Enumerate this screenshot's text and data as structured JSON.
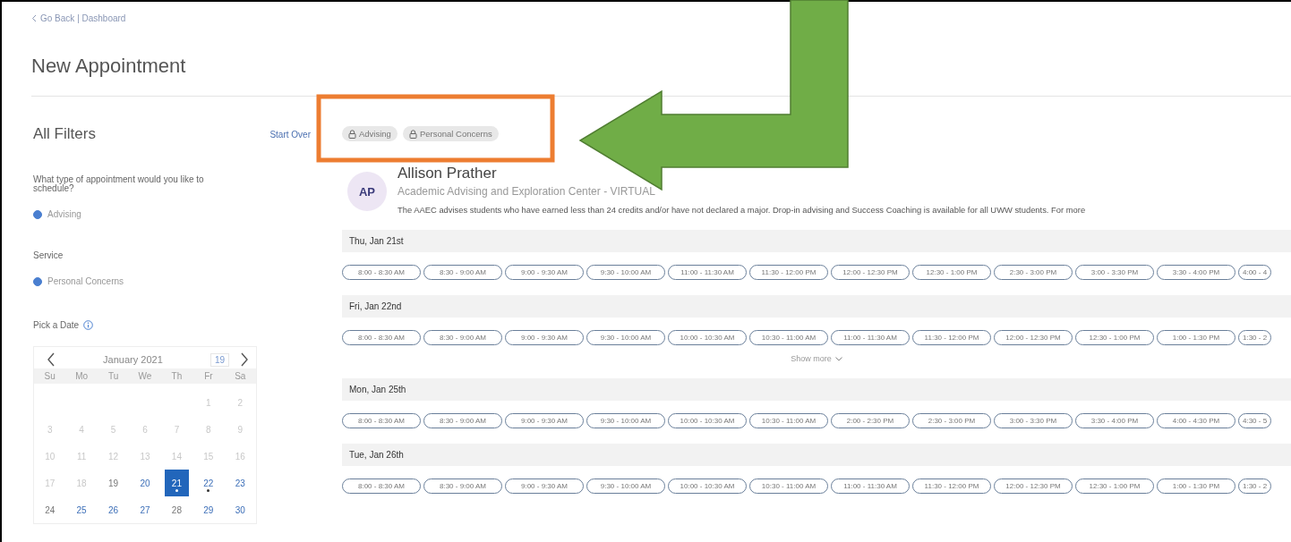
{
  "back_link": "Go Back | Dashboard",
  "page_title": "New Appointment",
  "filters": {
    "title": "All Filters",
    "reset": "Start Over",
    "groups": [
      {
        "label": "What type of appointment would you like to schedule?",
        "options": [
          {
            "label": "Advising",
            "selected": true
          }
        ]
      },
      {
        "label": "Service",
        "options": [
          {
            "label": "Personal Concerns",
            "selected": true
          }
        ]
      }
    ],
    "date_picker": {
      "label": "Pick a Date",
      "month": "January 2021",
      "today": "19",
      "weekdays": [
        "Su",
        "Mo",
        "Tu",
        "We",
        "Th",
        "Fr",
        "Sa"
      ],
      "weeks": [
        [
          {
            "label": "1",
            "disabled": true,
            "selected": false,
            "dot": false
          },
          {
            "label": "2",
            "disabled": true,
            "selected": false,
            "dot": false
          }
        ],
        [
          {
            "label": "3",
            "disabled": true,
            "selected": false,
            "dot": false
          },
          {
            "label": "4",
            "disabled": true,
            "selected": false,
            "dot": false
          },
          {
            "label": "5",
            "disabled": true,
            "selected": false,
            "dot": false
          },
          {
            "label": "6",
            "disabled": true,
            "selected": false,
            "dot": false
          },
          {
            "label": "7",
            "disabled": true,
            "selected": false,
            "dot": false
          },
          {
            "label": "8",
            "disabled": true,
            "selected": false,
            "dot": false
          },
          {
            "label": "9",
            "disabled": true,
            "selected": false,
            "dot": false
          }
        ],
        [
          {
            "label": "10",
            "disabled": true,
            "selected": false,
            "dot": false
          },
          {
            "label": "11",
            "disabled": true,
            "selected": false,
            "dot": false
          },
          {
            "label": "12",
            "disabled": true,
            "selected": false,
            "dot": false
          },
          {
            "label": "13",
            "disabled": true,
            "selected": false,
            "dot": false
          },
          {
            "label": "14",
            "disabled": true,
            "selected": false,
            "dot": false
          },
          {
            "label": "15",
            "disabled": true,
            "selected": false,
            "dot": false
          },
          {
            "label": "16",
            "disabled": true,
            "selected": false,
            "dot": false
          }
        ],
        [
          {
            "label": "17",
            "disabled": true,
            "selected": false,
            "dot": false
          },
          {
            "label": "18",
            "disabled": true,
            "selected": false,
            "dot": false
          },
          {
            "label": "19",
            "disabled": false,
            "available": false,
            "selected": false,
            "dot": false
          },
          {
            "label": "20",
            "disabled": false,
            "available": true,
            "selected": false,
            "dot": false
          },
          {
            "label": "21",
            "disabled": false,
            "available": true,
            "selected": true,
            "dot": true
          },
          {
            "label": "22",
            "disabled": false,
            "available": true,
            "selected": false,
            "dot": true
          },
          {
            "label": "23",
            "disabled": false,
            "available": true,
            "selected": false,
            "dot": false
          }
        ],
        [
          {
            "label": "24",
            "disabled": false,
            "available": false,
            "selected": false,
            "dot": false
          },
          {
            "label": "25",
            "disabled": false,
            "available": true,
            "selected": false,
            "dot": false
          },
          {
            "label": "26",
            "disabled": false,
            "available": true,
            "selected": false,
            "dot": false
          },
          {
            "label": "27",
            "disabled": false,
            "available": true,
            "selected": false,
            "dot": false
          },
          {
            "label": "28",
            "disabled": false,
            "available": false,
            "selected": false,
            "dot": false
          },
          {
            "label": "29",
            "disabled": false,
            "available": true,
            "selected": false,
            "dot": false
          },
          {
            "label": "30",
            "disabled": false,
            "available": true,
            "selected": false,
            "dot": false
          }
        ]
      ]
    }
  },
  "chips": [
    {
      "label": "Advising"
    },
    {
      "label": "Personal Concerns"
    }
  ],
  "advisor": {
    "initials": "AP",
    "name": "Allison Prather",
    "department": "Academic Advising and Exploration Center - VIRTUAL",
    "description": "The AAEC advises students who have earned less than 24 credits and/or have not declared a major. Drop-in advising and Success Coaching is available for all UWW students. For more"
  },
  "days": [
    {
      "date": "Thu, Jan 21st",
      "slots": [
        "8:00 - 8:30 AM",
        "8:30 - 9:00 AM",
        "9:00 - 9:30 AM",
        "9:30 - 10:00 AM",
        "11:00 - 11:30 AM",
        "11:30 - 12:00 PM",
        "12:00 - 12:30 PM",
        "12:30 - 1:00 PM",
        "2:30 - 3:00 PM",
        "3:00 - 3:30 PM",
        "3:30 - 4:00 PM",
        "4:00 - 4"
      ]
    },
    {
      "date": "Fri, Jan 22nd",
      "slots": [
        "8:00 - 8:30 AM",
        "8:30 - 9:00 AM",
        "9:00 - 9:30 AM",
        "9:30 - 10:00 AM",
        "10:00 - 10:30 AM",
        "10:30 - 11:00 AM",
        "11:00 - 11:30 AM",
        "11:30 - 12:00 PM",
        "12:00 - 12:30 PM",
        "12:30 - 1:00 PM",
        "1:00 - 1:30 PM",
        "1:30 - 2"
      ],
      "show_more": "Show more"
    },
    {
      "date": "Mon, Jan 25th",
      "slots": [
        "8:00 - 8:30 AM",
        "8:30 - 9:00 AM",
        "9:00 - 9:30 AM",
        "9:30 - 10:00 AM",
        "10:00 - 10:30 AM",
        "10:30 - 11:00 AM",
        "2:00 - 2:30 PM",
        "2:30 - 3:00 PM",
        "3:00 - 3:30 PM",
        "3:30 - 4:00 PM",
        "4:00 - 4:30 PM",
        "4:30 - 5"
      ]
    },
    {
      "date": "Tue, Jan 26th",
      "slots": [
        "8:00 - 8:30 AM",
        "8:30 - 9:00 AM",
        "9:00 - 9:30 AM",
        "9:30 - 10:00 AM",
        "10:00 - 10:30 AM",
        "10:30 - 11:00 AM",
        "11:00 - 11:30 AM",
        "11:30 - 12:00 PM",
        "12:00 - 12:30 PM",
        "12:30 - 1:00 PM",
        "1:00 - 1:30 PM",
        "1:30 - 2"
      ]
    }
  ]
}
